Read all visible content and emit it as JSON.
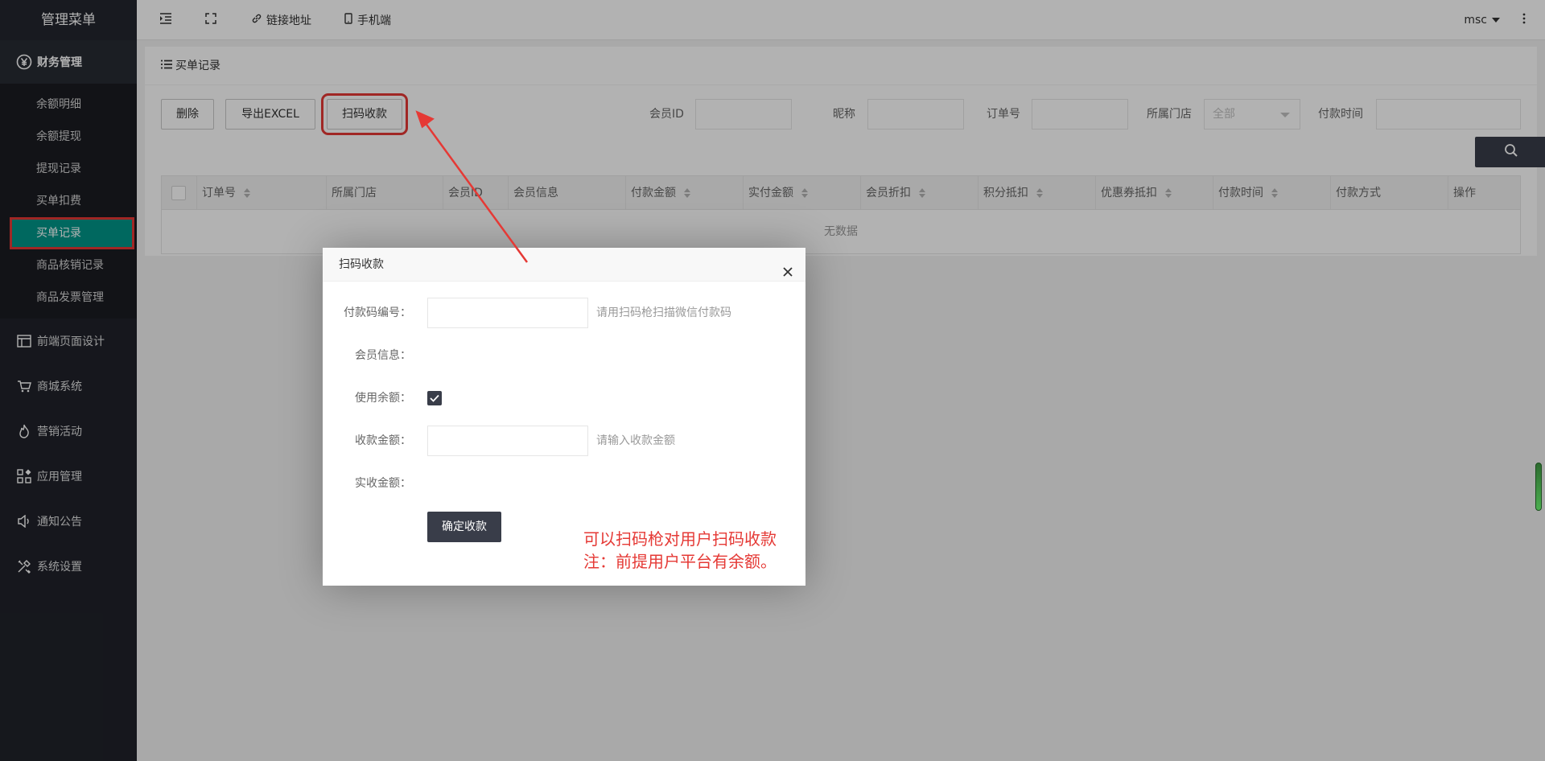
{
  "sidebar": {
    "title": "管理菜单",
    "groups": [
      {
        "label": "财务管理",
        "icon": "yen-circle-icon"
      },
      {
        "label": "前端页面设计",
        "icon": "layout-icon"
      },
      {
        "label": "商城系统",
        "icon": "cart-icon"
      },
      {
        "label": "营销活动",
        "icon": "flame-icon"
      },
      {
        "label": "应用管理",
        "icon": "apps-icon"
      },
      {
        "label": "通知公告",
        "icon": "speaker-icon"
      },
      {
        "label": "系统设置",
        "icon": "tools-icon"
      }
    ],
    "finance_items": [
      "余额明细",
      "余额提现",
      "提现记录",
      "买单扣费",
      "买单记录",
      "商品核销记录",
      "商品发票管理"
    ]
  },
  "topbar": {
    "link_label": "链接地址",
    "mobile_label": "手机端",
    "user": "msc"
  },
  "card": {
    "title": "买单记录",
    "buttons": {
      "delete": "删除",
      "export": "导出EXCEL",
      "scan": "扫码收款"
    },
    "filters": {
      "member_id": "会员ID",
      "nickname": "昵称",
      "order_no": "订单号",
      "store": "所属门店",
      "store_value": "全部",
      "pay_time": "付款时间"
    },
    "table": {
      "columns": [
        "订单号",
        "所属门店",
        "会员ID",
        "会员信息",
        "付款金额",
        "实付金额",
        "会员折扣",
        "积分抵扣",
        "优惠券抵扣",
        "付款时间",
        "付款方式",
        "操作"
      ],
      "empty": "无数据"
    }
  },
  "modal": {
    "title": "扫码收款",
    "pay_code_label": "付款码编号：",
    "pay_code_hint": "请用扫码枪扫描微信付款码",
    "member_info_label": "会员信息：",
    "use_balance_label": "使用余额：",
    "use_balance_checked": true,
    "amount_label": "收款金额：",
    "amount_hint": "请输入收款金额",
    "actual_label": "实收金额：",
    "confirm_button": "确定收款"
  },
  "annotation": {
    "line1": "可以扫码枪对用户扫码收款",
    "line2": "注：前提用户平台有余额。",
    "color": "#e53935"
  },
  "colors": {
    "sidebar_bg": "#20222a",
    "active_item": "#009688",
    "dark_button": "#393d49"
  }
}
